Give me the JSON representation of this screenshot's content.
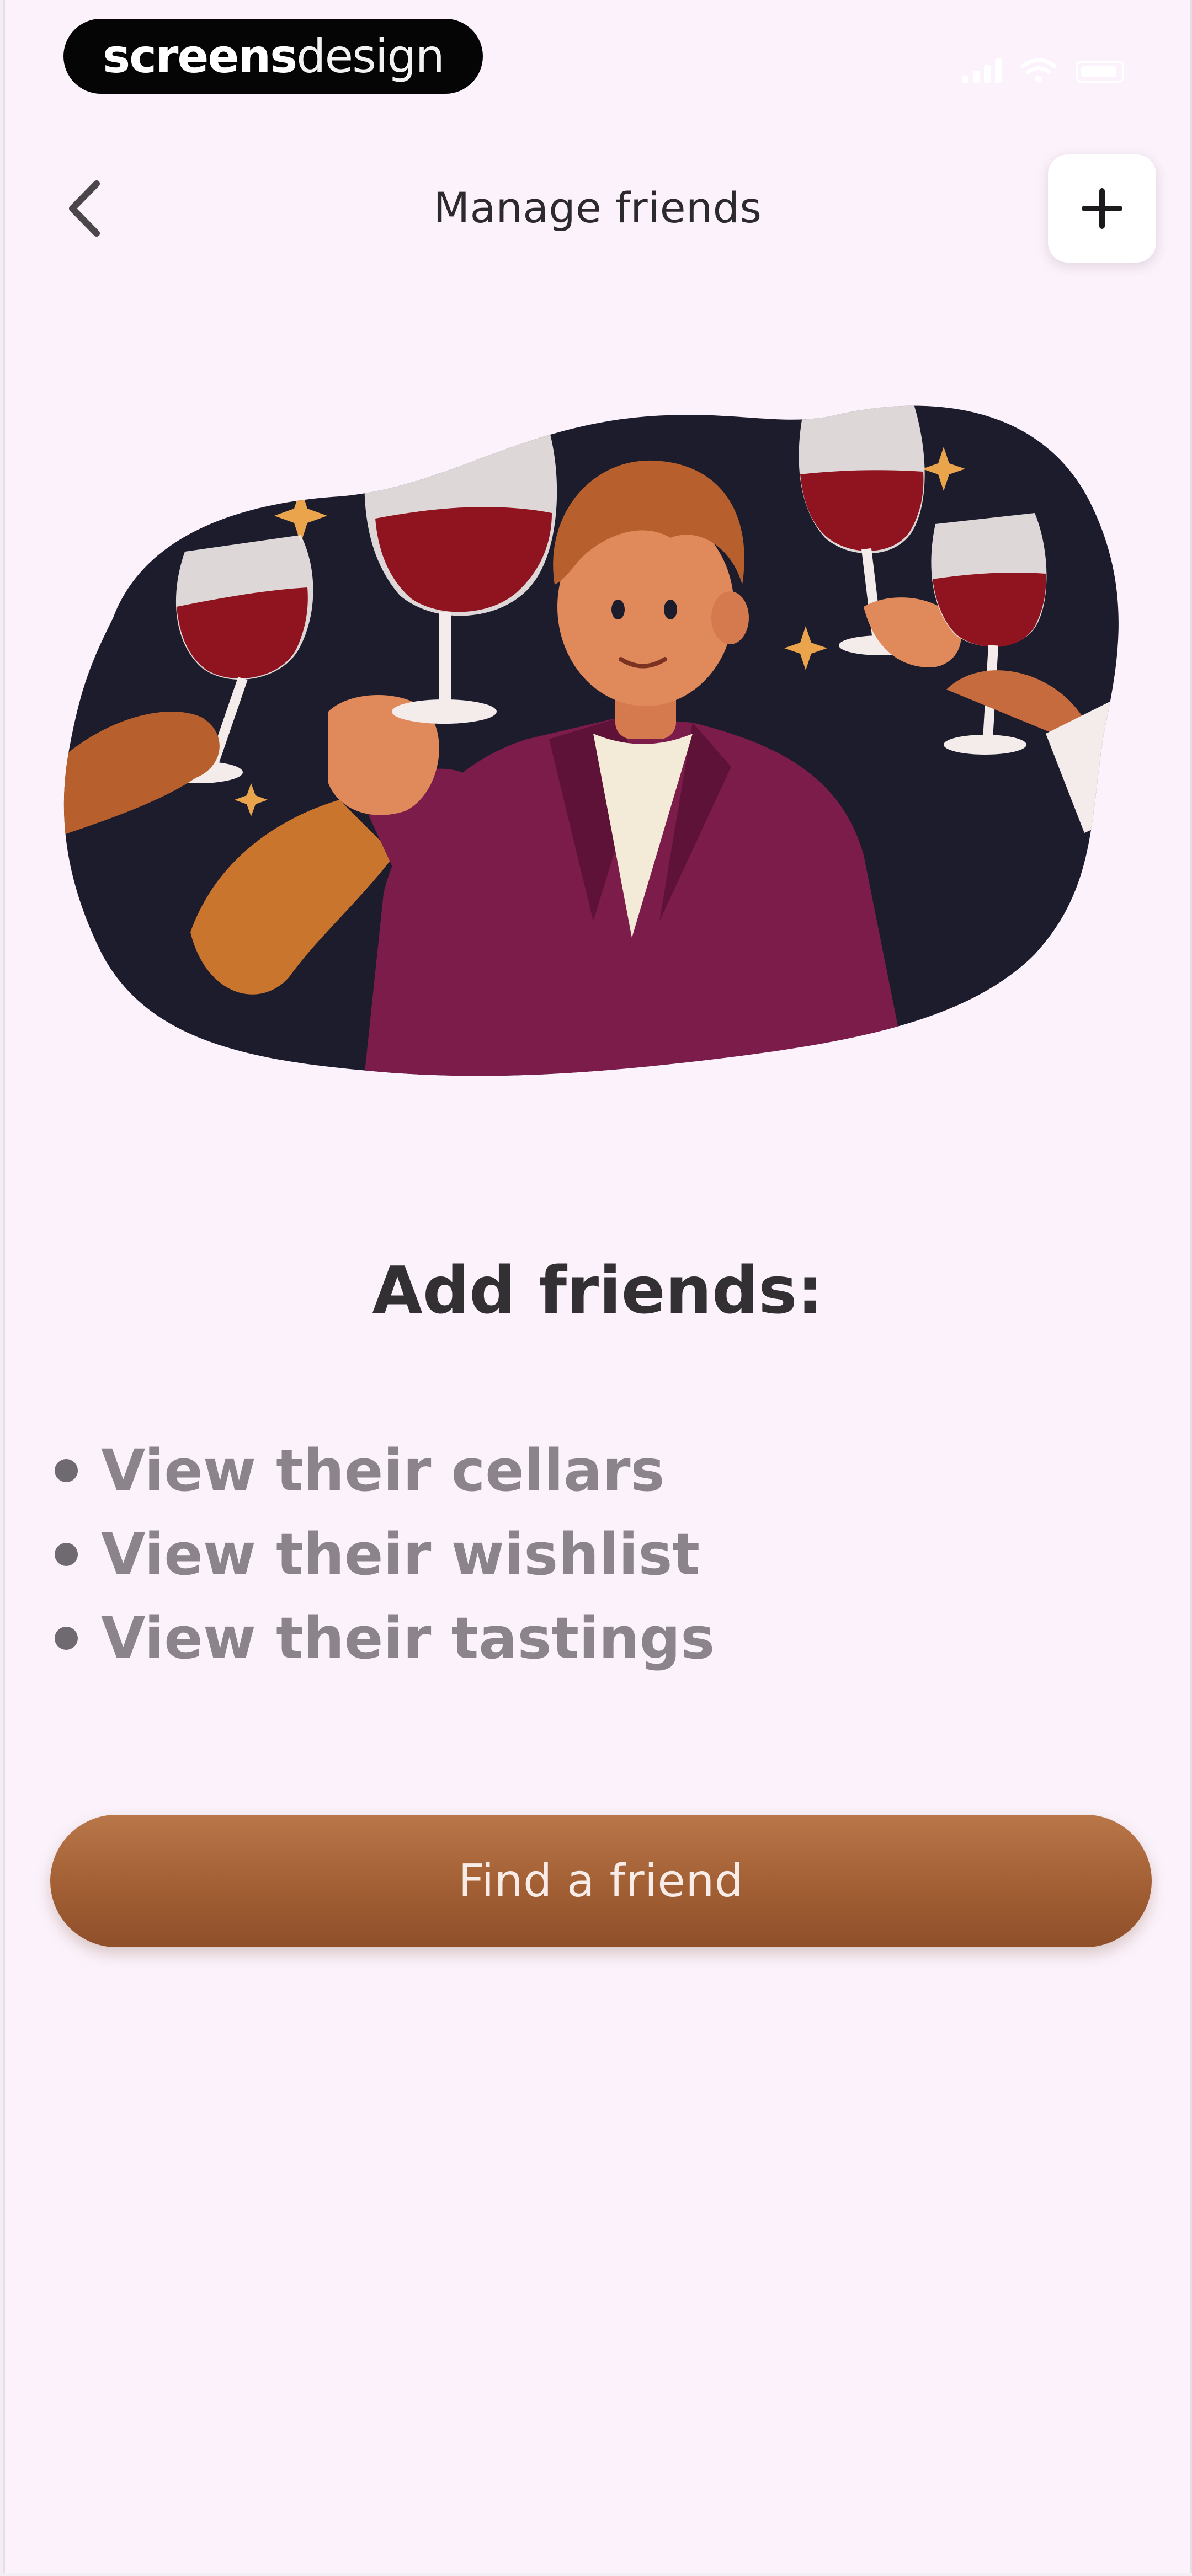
{
  "status_bar": {
    "watermark_bold": "screens",
    "watermark_light": "design"
  },
  "header": {
    "back_icon": "chevron-left-icon",
    "title": "Manage friends",
    "add_icon": "plus-icon"
  },
  "illustration": {
    "subject": "friends-toasting-wine-illustration"
  },
  "content": {
    "heading": "Add friends:",
    "benefits": [
      "View their cellars",
      "View their wishlist",
      "View their tastings"
    ]
  },
  "actions": {
    "find_friend_label": "Find a friend"
  },
  "colors": {
    "background": "#fbf2fb",
    "accent": "#a25f34",
    "illustration_backdrop": "#1d1c2c",
    "jacket": "#7b1c4b",
    "wine": "#8f1420"
  }
}
